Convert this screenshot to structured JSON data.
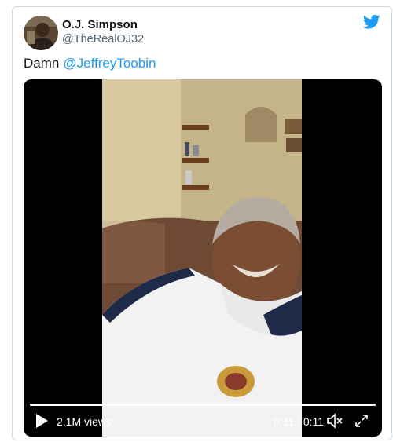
{
  "tweet": {
    "author_name": "O.J. Simpson",
    "author_handle": "@TheRealOJ32",
    "text": "Damn",
    "mention": "@JeffreyToobin"
  },
  "video": {
    "views": "2.1M views",
    "time": "0:11 / 0:11",
    "progress": 1.0
  },
  "icons": {
    "brand": "twitter-bird-icon",
    "play": "play-icon",
    "volume": "volume-muted-icon",
    "fullscreen": "fullscreen-icon"
  },
  "colors": {
    "accent": "#1d9bf0",
    "name": "#0f1419",
    "secondary": "#536471",
    "video_bg": "#000000"
  }
}
